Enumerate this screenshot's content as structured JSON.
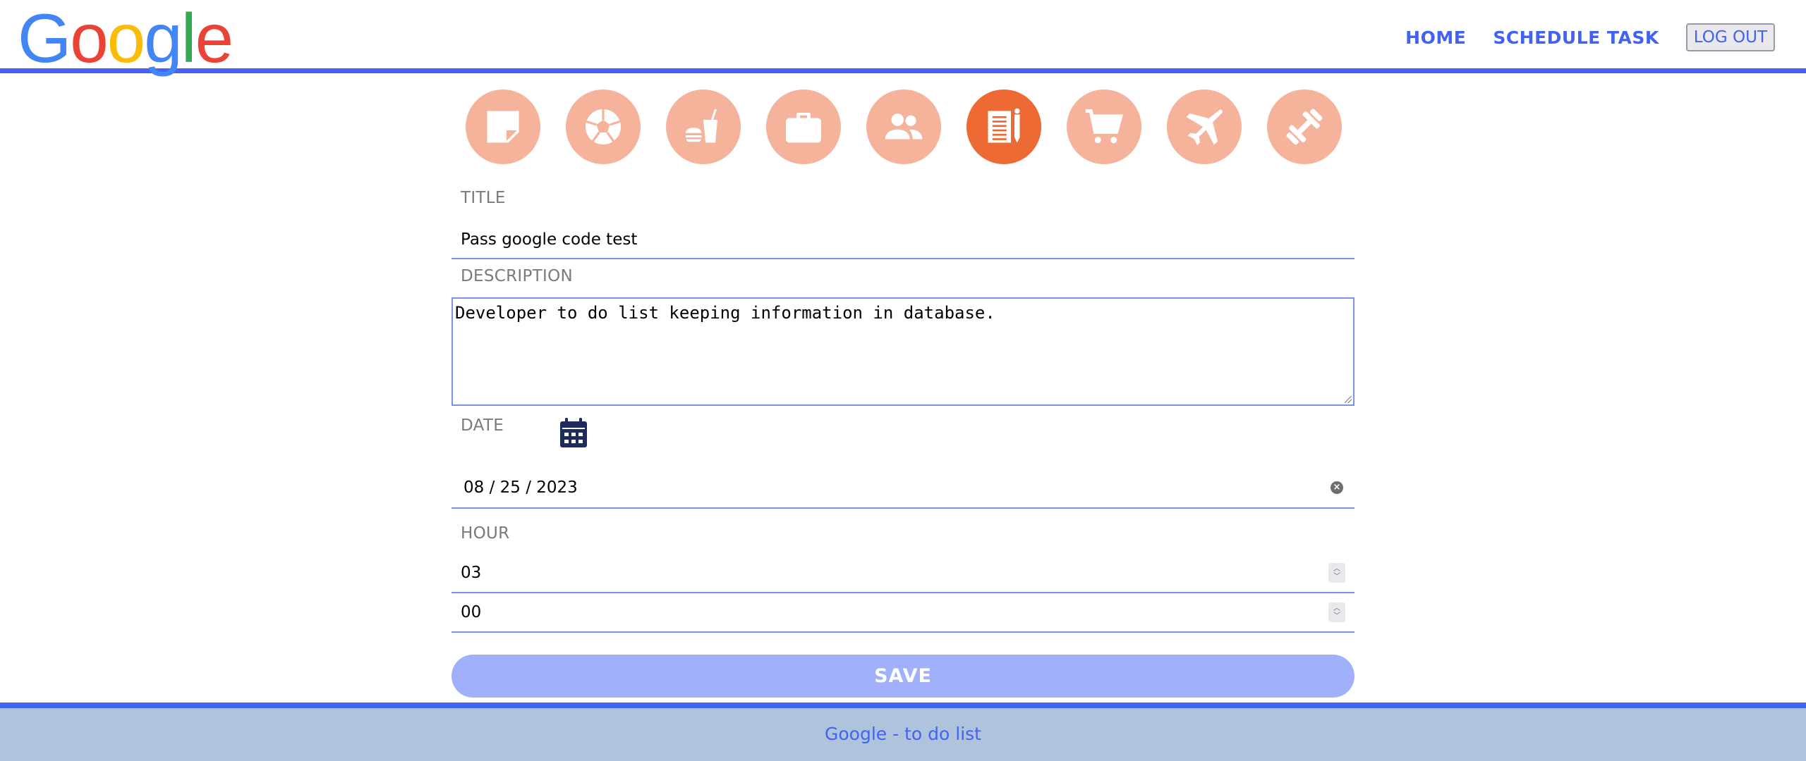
{
  "logo": {
    "letters": [
      {
        "char": "G",
        "color": "#4285f4"
      },
      {
        "char": "o",
        "color": "#ea4335"
      },
      {
        "char": "o",
        "color": "#fbbc05"
      },
      {
        "char": "g",
        "color": "#4285f4"
      },
      {
        "char": "l",
        "color": "#34a853"
      },
      {
        "char": "e",
        "color": "#ea4335"
      }
    ]
  },
  "nav": {
    "home": "HOME",
    "schedule_task": "SCHEDULE TASK",
    "logout": "LOG OUT"
  },
  "categories": [
    {
      "icon": "sticky-note-icon",
      "active": false
    },
    {
      "icon": "soccer-ball-icon",
      "active": false
    },
    {
      "icon": "food-drink-icon",
      "active": false
    },
    {
      "icon": "briefcase-icon",
      "active": false
    },
    {
      "icon": "people-icon",
      "active": false
    },
    {
      "icon": "newspaper-pencil-icon",
      "active": true
    },
    {
      "icon": "shopping-cart-icon",
      "active": false
    },
    {
      "icon": "airplane-icon",
      "active": false
    },
    {
      "icon": "dumbbell-icon",
      "active": false
    }
  ],
  "form": {
    "title_label": "TITLE",
    "title_value": "Pass google code test",
    "description_label": "DESCRIPTION",
    "description_value": "Developer to do list keeping information in database.",
    "date_label": "DATE",
    "date_value": "08 / 25 / 2023",
    "hour_label": "HOUR",
    "hour_value": "03",
    "minute_value": "00",
    "save_label": "SAVE"
  },
  "footer": {
    "text": "Google - to do list"
  },
  "colors": {
    "accent": "#4162f2",
    "category_inactive": "#f5b39b",
    "category_active": "#ee6a35",
    "save_button": "#a1b0fb",
    "footer_bg": "#b0c3dd"
  }
}
